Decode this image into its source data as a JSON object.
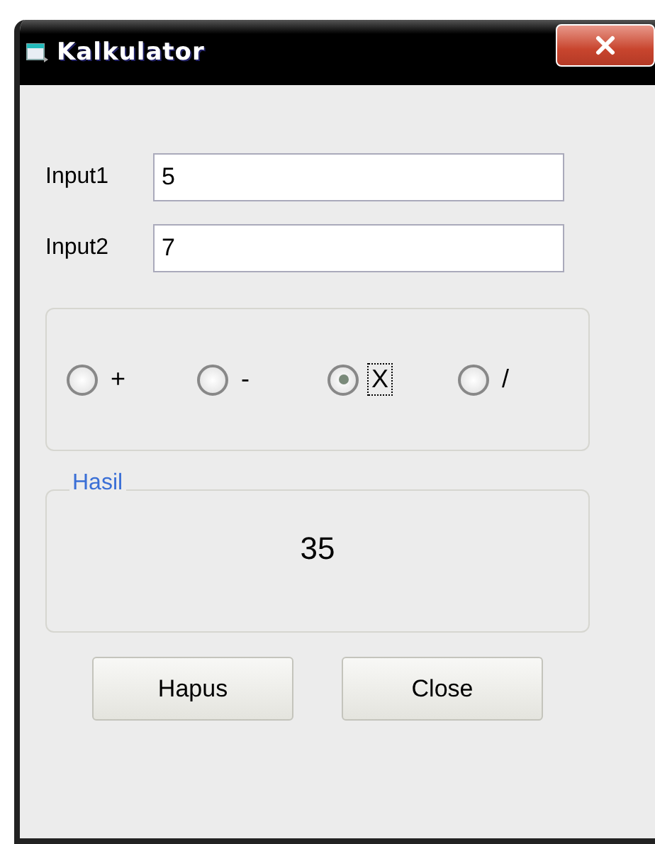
{
  "window": {
    "title": "Kalkulator"
  },
  "inputs": [
    {
      "label": "Input1",
      "value": "5"
    },
    {
      "label": "Input2",
      "value": "7"
    }
  ],
  "operations": [
    {
      "label": "+",
      "selected": false,
      "focused": false
    },
    {
      "label": "-",
      "selected": false,
      "focused": false
    },
    {
      "label": "X",
      "selected": true,
      "focused": true
    },
    {
      "label": "/",
      "selected": false,
      "focused": false
    }
  ],
  "result": {
    "legend": "Hasil",
    "value": "35"
  },
  "buttons": [
    "Hapus",
    "Close"
  ]
}
